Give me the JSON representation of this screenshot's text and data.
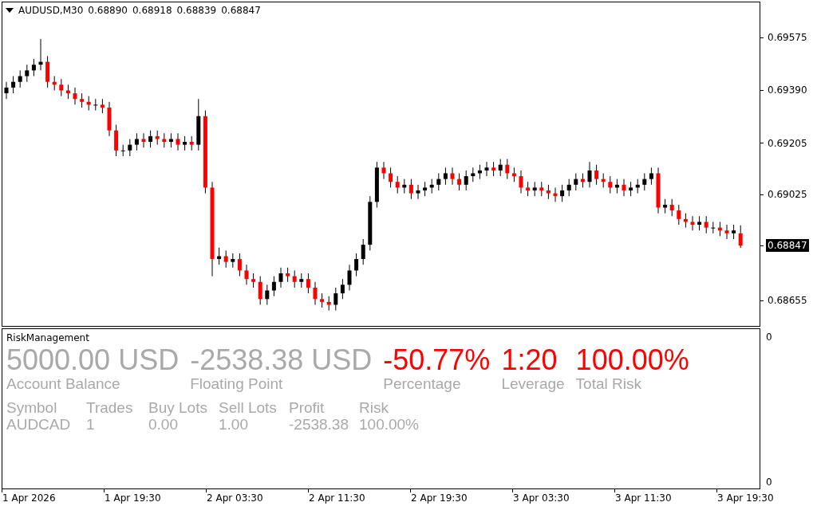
{
  "chart": {
    "symbol": "AUDUSD,M30",
    "ohlc": [
      "0.68890",
      "0.68918",
      "0.68839",
      "0.68847"
    ],
    "chart_data": {
      "type": "candlestick",
      "categories": [
        null,
        null,
        null,
        null,
        null,
        null,
        null,
        null,
        null,
        null,
        null,
        null,
        null,
        null,
        null,
        null,
        null,
        null,
        null,
        null,
        null,
        null,
        null,
        null,
        null,
        null,
        null,
        null,
        null,
        null,
        null,
        null,
        null,
        null,
        null,
        null,
        null,
        null,
        null,
        null,
        null,
        null,
        null,
        null,
        null,
        null,
        null,
        null,
        null,
        null,
        null,
        null,
        null,
        null,
        null,
        null,
        null,
        null,
        null,
        null,
        null,
        null,
        null,
        null,
        null,
        null,
        null,
        null,
        null,
        null,
        null,
        null,
        null,
        null,
        null,
        null,
        null,
        null,
        null,
        null,
        null,
        null,
        null,
        null,
        null,
        null,
        null,
        null,
        null,
        null,
        null,
        null,
        null,
        null,
        null,
        null,
        null,
        null,
        null,
        null,
        null,
        null,
        null,
        null,
        null,
        null,
        null,
        null
      ],
      "ylim": [
        0.68566,
        0.69698
      ],
      "yticks": [
        {
          "value": 0.69575,
          "label": "0.69575"
        },
        {
          "value": 0.6939,
          "label": "0.69390"
        },
        {
          "value": 0.69205,
          "label": "0.69205"
        },
        {
          "value": 0.69025,
          "label": "0.69025"
        },
        {
          "value": 0.68655,
          "label": "0.68655"
        }
      ],
      "ohlc": [
        [
          0.6938,
          0.6942,
          0.6936,
          0.694
        ],
        [
          0.694,
          0.6944,
          0.6938,
          0.6942
        ],
        [
          0.6942,
          0.6946,
          0.694,
          0.6944
        ],
        [
          0.6944,
          0.6948,
          0.6942,
          0.6946
        ],
        [
          0.6946,
          0.695,
          0.6944,
          0.6948
        ],
        [
          0.6948,
          0.6957,
          0.6946,
          0.6949
        ],
        [
          0.6949,
          0.6951,
          0.694,
          0.6942
        ],
        [
          0.6942,
          0.6944,
          0.6939,
          0.6941
        ],
        [
          0.6941,
          0.6943,
          0.6937,
          0.6939
        ],
        [
          0.6939,
          0.6941,
          0.6936,
          0.6938
        ],
        [
          0.6938,
          0.694,
          0.6934,
          0.6936
        ],
        [
          0.6936,
          0.6938,
          0.6933,
          0.6935
        ],
        [
          0.6935,
          0.6937,
          0.6932,
          0.6934
        ],
        [
          0.6934,
          0.6936,
          0.6932,
          0.6934
        ],
        [
          0.6934,
          0.6936,
          0.6931,
          0.6933
        ],
        [
          0.6933,
          0.6935,
          0.6923,
          0.6925
        ],
        [
          0.6925,
          0.6927,
          0.6916,
          0.6918
        ],
        [
          0.6918,
          0.692,
          0.6916,
          0.6918
        ],
        [
          0.6918,
          0.6922,
          0.6916,
          0.692
        ],
        [
          0.692,
          0.6924,
          0.6918,
          0.6922
        ],
        [
          0.6922,
          0.6924,
          0.6919,
          0.6921
        ],
        [
          0.6921,
          0.6925,
          0.6919,
          0.6923
        ],
        [
          0.6923,
          0.6925,
          0.692,
          0.6922
        ],
        [
          0.6922,
          0.6924,
          0.6919,
          0.6921
        ],
        [
          0.6921,
          0.6924,
          0.6919,
          0.6922
        ],
        [
          0.6922,
          0.6924,
          0.6918,
          0.692
        ],
        [
          0.692,
          0.6923,
          0.6918,
          0.6921
        ],
        [
          0.6921,
          0.6923,
          0.6918,
          0.692
        ],
        [
          0.692,
          0.6936,
          0.6918,
          0.693
        ],
        [
          0.693,
          0.6932,
          0.6903,
          0.6905
        ],
        [
          0.6905,
          0.6907,
          0.6874,
          0.688
        ],
        [
          0.688,
          0.6884,
          0.6878,
          0.6881
        ],
        [
          0.6881,
          0.6883,
          0.6877,
          0.6879
        ],
        [
          0.6879,
          0.6882,
          0.6877,
          0.688
        ],
        [
          0.688,
          0.6882,
          0.6874,
          0.6876
        ],
        [
          0.6876,
          0.6878,
          0.6871,
          0.6873
        ],
        [
          0.6873,
          0.6875,
          0.687,
          0.6872
        ],
        [
          0.6872,
          0.6874,
          0.6864,
          0.6866
        ],
        [
          0.6866,
          0.6871,
          0.6864,
          0.6869
        ],
        [
          0.6869,
          0.6874,
          0.6867,
          0.6872
        ],
        [
          0.6872,
          0.6877,
          0.687,
          0.6875
        ],
        [
          0.6875,
          0.6877,
          0.6872,
          0.6874
        ],
        [
          0.6874,
          0.6876,
          0.687,
          0.6872
        ],
        [
          0.6872,
          0.6875,
          0.687,
          0.6873
        ],
        [
          0.6873,
          0.6875,
          0.6868,
          0.687
        ],
        [
          0.687,
          0.6872,
          0.6864,
          0.6866
        ],
        [
          0.6866,
          0.6868,
          0.6863,
          0.6865
        ],
        [
          0.6865,
          0.6867,
          0.6862,
          0.6864
        ],
        [
          0.6864,
          0.687,
          0.6862,
          0.6868
        ],
        [
          0.6868,
          0.6873,
          0.6866,
          0.6871
        ],
        [
          0.6871,
          0.6878,
          0.6869,
          0.6876
        ],
        [
          0.6876,
          0.6882,
          0.6874,
          0.688
        ],
        [
          0.688,
          0.6887,
          0.6878,
          0.6885
        ],
        [
          0.6885,
          0.6902,
          0.6883,
          0.69
        ],
        [
          0.69,
          0.6914,
          0.6898,
          0.6912
        ],
        [
          0.6912,
          0.6914,
          0.6908,
          0.691
        ],
        [
          0.691,
          0.6912,
          0.6905,
          0.6907
        ],
        [
          0.6907,
          0.6909,
          0.6903,
          0.6905
        ],
        [
          0.6905,
          0.6908,
          0.6903,
          0.6906
        ],
        [
          0.6906,
          0.6908,
          0.6901,
          0.6903
        ],
        [
          0.6903,
          0.6906,
          0.6901,
          0.6904
        ],
        [
          0.6904,
          0.6907,
          0.6902,
          0.6905
        ],
        [
          0.6905,
          0.6908,
          0.6903,
          0.6906
        ],
        [
          0.6906,
          0.691,
          0.6904,
          0.6908
        ],
        [
          0.6908,
          0.6912,
          0.6906,
          0.691
        ],
        [
          0.691,
          0.6912,
          0.6906,
          0.6908
        ],
        [
          0.6908,
          0.691,
          0.6904,
          0.6906
        ],
        [
          0.6906,
          0.6911,
          0.6904,
          0.6909
        ],
        [
          0.6909,
          0.6912,
          0.6907,
          0.691
        ],
        [
          0.691,
          0.6913,
          0.6908,
          0.6911
        ],
        [
          0.6911,
          0.6914,
          0.6909,
          0.6912
        ],
        [
          0.6912,
          0.6914,
          0.6909,
          0.6911
        ],
        [
          0.6911,
          0.6915,
          0.6909,
          0.6913
        ],
        [
          0.6913,
          0.6915,
          0.6908,
          0.691
        ],
        [
          0.691,
          0.6912,
          0.6907,
          0.6909
        ],
        [
          0.6909,
          0.6911,
          0.6903,
          0.6905
        ],
        [
          0.6905,
          0.6907,
          0.6902,
          0.6904
        ],
        [
          0.6904,
          0.6907,
          0.6902,
          0.6905
        ],
        [
          0.6905,
          0.6907,
          0.6902,
          0.6904
        ],
        [
          0.6904,
          0.6906,
          0.6901,
          0.6903
        ],
        [
          0.6903,
          0.6905,
          0.69,
          0.6902
        ],
        [
          0.6902,
          0.6906,
          0.69,
          0.6904
        ],
        [
          0.6904,
          0.6908,
          0.6902,
          0.6906
        ],
        [
          0.6906,
          0.691,
          0.6904,
          0.6908
        ],
        [
          0.6908,
          0.691,
          0.6905,
          0.6907
        ],
        [
          0.6907,
          0.6914,
          0.6905,
          0.6911
        ],
        [
          0.6911,
          0.6913,
          0.6906,
          0.6908
        ],
        [
          0.6908,
          0.691,
          0.6905,
          0.6907
        ],
        [
          0.6907,
          0.6909,
          0.6903,
          0.6905
        ],
        [
          0.6905,
          0.6908,
          0.6903,
          0.6906
        ],
        [
          0.6906,
          0.6908,
          0.6902,
          0.6904
        ],
        [
          0.6904,
          0.6907,
          0.6902,
          0.6905
        ],
        [
          0.6905,
          0.6908,
          0.6903,
          0.6906
        ],
        [
          0.6906,
          0.691,
          0.6904,
          0.6908
        ],
        [
          0.6908,
          0.6912,
          0.6906,
          0.691
        ],
        [
          0.691,
          0.6912,
          0.6896,
          0.6898
        ],
        [
          0.6898,
          0.6901,
          0.6896,
          0.6899
        ],
        [
          0.6899,
          0.6901,
          0.6895,
          0.6897
        ],
        [
          0.6897,
          0.6899,
          0.6892,
          0.6894
        ],
        [
          0.6894,
          0.6896,
          0.6891,
          0.6893
        ],
        [
          0.6893,
          0.6895,
          0.689,
          0.6892
        ],
        [
          0.6892,
          0.6895,
          0.689,
          0.6893
        ],
        [
          0.6893,
          0.6895,
          0.6889,
          0.6891
        ],
        [
          0.6891,
          0.6893,
          0.6889,
          0.6891
        ],
        [
          0.6891,
          0.6893,
          0.6888,
          0.689
        ],
        [
          0.689,
          0.6892,
          0.6887,
          0.6889
        ],
        [
          0.6889,
          0.6892,
          0.6887,
          0.689
        ],
        [
          0.6889,
          0.68918,
          0.68839,
          0.68847
        ]
      ]
    },
    "current_price": "0.68847"
  },
  "indicator": {
    "title": "RiskManagement",
    "summary": [
      {
        "value": "5000.00 USD",
        "label": "Account Balance",
        "color": "#a9a9a9"
      },
      {
        "value": "-2538.38 USD",
        "label": "Floating Point",
        "color": "#a9a9a9"
      },
      {
        "value": "-50.77%",
        "label": "Percentage",
        "color": "#ff0000"
      },
      {
        "value": "1:20",
        "label": "Leverage",
        "color": "#ff0000"
      },
      {
        "value": "100.00%",
        "label": "Total Risk",
        "color": "#ff0000"
      }
    ],
    "table": {
      "columns": [
        "Symbol",
        "Trades",
        "Buy Lots",
        "Sell Lots",
        "Profit",
        "Risk"
      ],
      "rows": [
        [
          "AUDCAD",
          "1",
          "0.00",
          "1.00",
          "-2538.38",
          "100.00%"
        ]
      ]
    },
    "axis": [
      "0",
      "0"
    ]
  },
  "time_axis": [
    "1 Apr 2026",
    "1 Apr 19:30",
    "2 Apr 03:30",
    "2 Apr 11:30",
    "2 Apr 19:30",
    "3 Apr 03:30",
    "3 Apr 11:30",
    "3 Apr 19:30"
  ]
}
